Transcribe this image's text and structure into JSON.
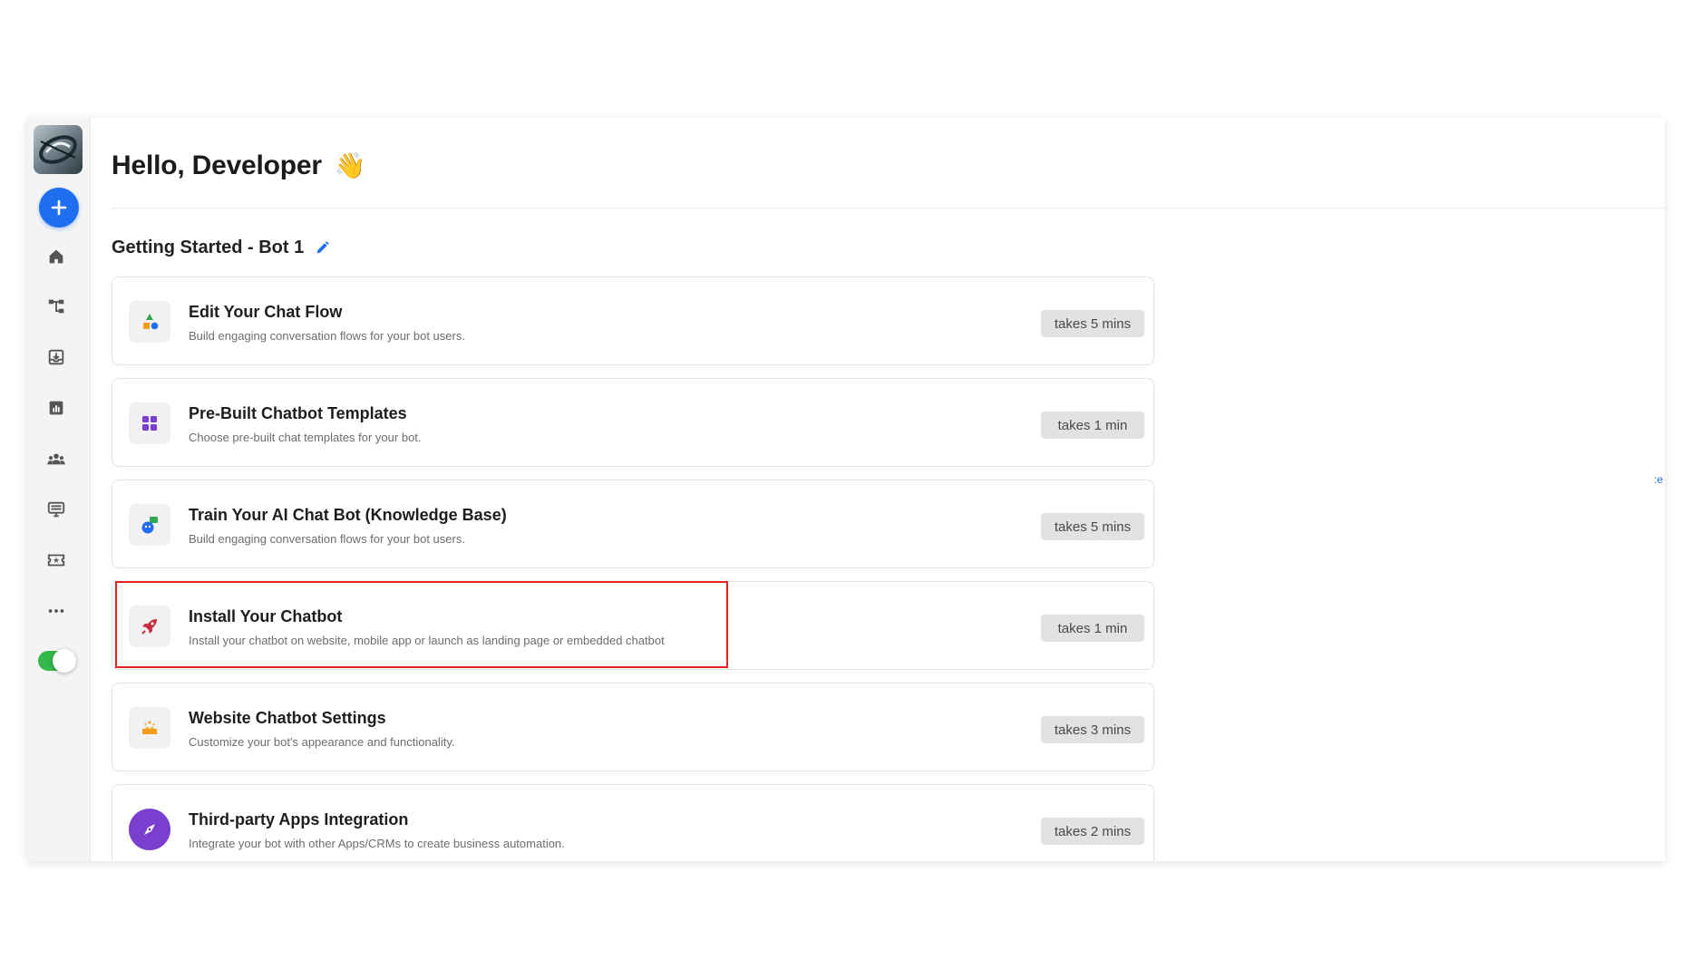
{
  "header": {
    "greeting": "Hello, Developer",
    "wave_emoji": "👋"
  },
  "section": {
    "title": "Getting Started - Bot 1"
  },
  "sidebar": {
    "items": [
      {
        "name": "home-icon"
      },
      {
        "name": "flow-icon"
      },
      {
        "name": "inbox-icon"
      },
      {
        "name": "analytics-icon"
      },
      {
        "name": "users-icon"
      },
      {
        "name": "monitor-icon"
      },
      {
        "name": "ticket-icon"
      },
      {
        "name": "more-icon"
      }
    ],
    "toggle_on": true
  },
  "cards": [
    {
      "title": "Edit Your Chat Flow",
      "description": "Build engaging conversation flows for your bot users.",
      "time": "takes 5 mins",
      "icon": "shapes-icon"
    },
    {
      "title": "Pre-Built Chatbot Templates",
      "description": "Choose pre-built chat templates for your bot.",
      "time": "takes 1 min",
      "icon": "grid-icon"
    },
    {
      "title": "Train Your AI Chat Bot (Knowledge Base)",
      "description": "Build engaging conversation flows for your bot users.",
      "time": "takes 5 mins",
      "icon": "ai-chat-icon"
    },
    {
      "title": "Install Your Chatbot",
      "description": "Install your chatbot on website, mobile app or launch as landing page or embedded chatbot",
      "time": "takes 1 min",
      "icon": "rocket-icon"
    },
    {
      "title": "Website Chatbot Settings",
      "description": "Customize your bot's appearance and functionality.",
      "time": "takes 3 mins",
      "icon": "settings-bot-icon"
    },
    {
      "title": "Third-party Apps Integration",
      "description": "Integrate your bot with other Apps/CRMs to create business automation.",
      "time": "takes 2 mins",
      "icon": "compass-icon"
    }
  ],
  "edge_glyph": ":e",
  "colors": {
    "accent": "#1f6ef0",
    "toggle": "#34b84a",
    "highlight": "#e02424"
  }
}
